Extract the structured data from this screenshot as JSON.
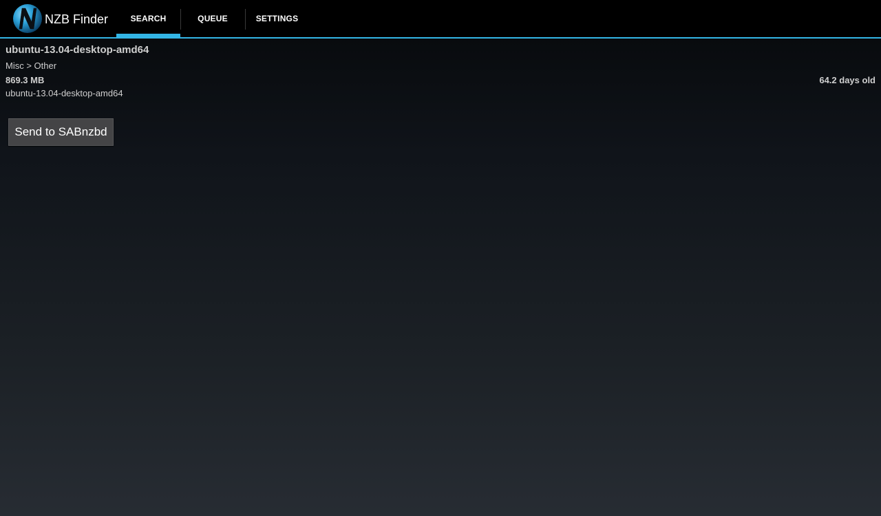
{
  "app": {
    "title": "NZB Finder",
    "logo_icon": "nzb-finder-logo-icon",
    "logo_letter": "N",
    "accent_color": "#33b5e5"
  },
  "tabs": [
    {
      "label": "SEARCH",
      "selected": true
    },
    {
      "label": "QUEUE",
      "selected": false
    },
    {
      "label": "SETTINGS",
      "selected": false
    }
  ],
  "result": {
    "title": "ubuntu-13.04-desktop-amd64",
    "category": "Misc > Other",
    "size": "869.3 MB",
    "age": "64.2 days old",
    "name": "ubuntu-13.04-desktop-amd64"
  },
  "actions": {
    "send_label": "Send to SABnzbd"
  }
}
